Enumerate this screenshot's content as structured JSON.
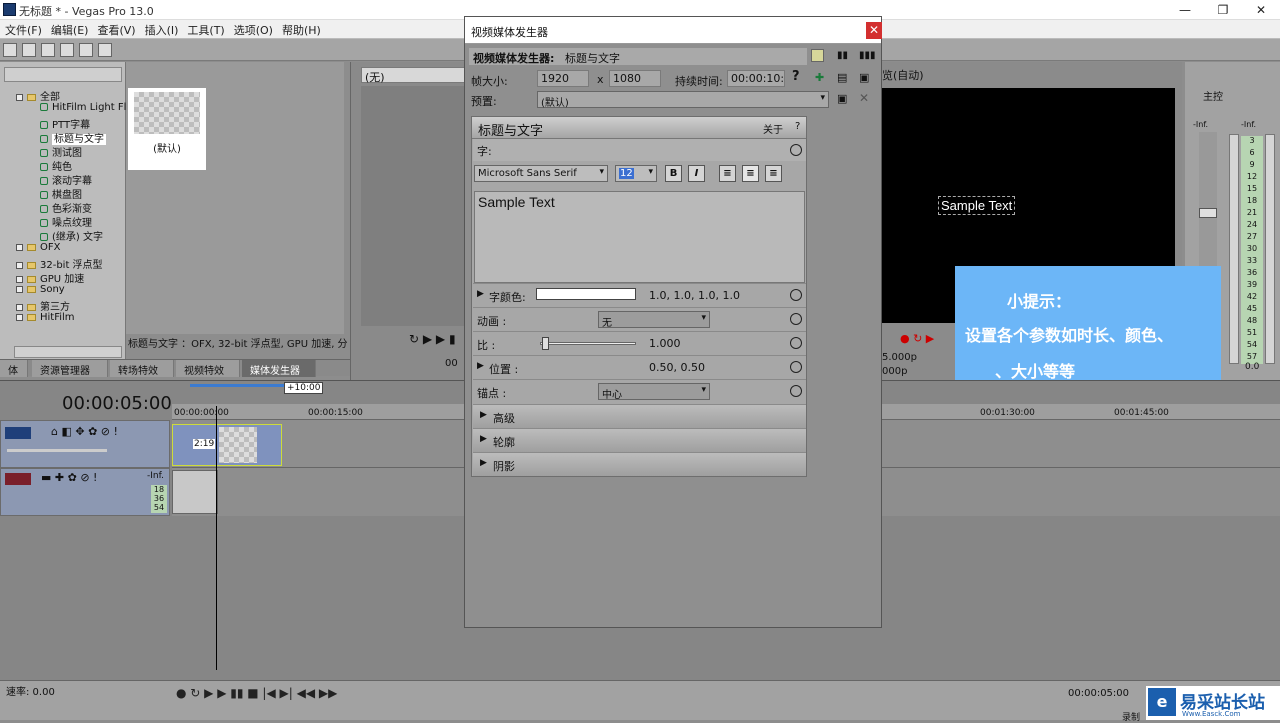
{
  "app": {
    "title": "无标题 * - Vegas Pro 13.0"
  },
  "menu": [
    "文件(F)",
    "编辑(E)",
    "查看(V)",
    "插入(I)",
    "工具(T)",
    "选项(O)",
    "帮助(H)"
  ],
  "explorer": {
    "root": "全部",
    "items": [
      "HitFilm Light Fla",
      "PTT字幕",
      "标题与文字",
      "测试图",
      "纯色",
      "滚动字幕",
      "棋盘图",
      "色彩渐变",
      "噪点纹理",
      "(继承) 文字"
    ],
    "folders": [
      "OFX",
      "32-bit 浮点型",
      "GPU 加速",
      "Sony",
      "第三方",
      "HitFilm"
    ],
    "selected_item": "标题与文字"
  },
  "preset_thumb": {
    "label": "(默认)"
  },
  "status_line": "标题与文字 ：OFX, 32-bit 浮点型, GPU 加速, 分",
  "bottom_tabs": [
    "体",
    "资源管理器",
    "转场特效",
    "视频特效",
    "媒体发生器"
  ],
  "bottom_tab_active": "媒体发生器",
  "trimmer": {
    "dropdown": "(无)",
    "time": "00"
  },
  "dialog": {
    "title": "视频媒体发生器",
    "header_label": "视频媒体发生器:",
    "header_value": "标题与文字",
    "frame_size_label": "帧大小:",
    "width": "1920",
    "x_sep": "x",
    "height": "1080",
    "duration_label": "持续时间:",
    "duration": "00:00:10:00",
    "help": "?",
    "preset_label": "预置:",
    "preset_value": "(默认)",
    "panel_title": "标题与文字",
    "about": "关于",
    "about_help": "?",
    "text_label": "字:",
    "font": "Microsoft Sans Serif",
    "font_size": "12",
    "bold": "B",
    "italic": "I",
    "sample_text": "Sample Text",
    "text_color_label": "字颜色:",
    "text_color_value": "1.0, 1.0, 1.0, 1.0",
    "animation_label": "动画 :",
    "animation_value": "无",
    "scale_label": "比 :",
    "scale_value": "1.000",
    "position_label": "位置 :",
    "position_value": "0.50, 0.50",
    "anchor_label": "锚点 :",
    "anchor_value": "中心",
    "advanced": "高级",
    "outline": "轮廓",
    "shadow": "阴影"
  },
  "preview": {
    "mode": "览(自动)",
    "overlay_text": "Sample Text",
    "info1": "5.000p",
    "info2": "000p"
  },
  "mixer": {
    "label": "主控",
    "meter_top": "-Inf.",
    "meter_ticks": [
      "3",
      "6",
      "9",
      "12",
      "15",
      "18",
      "21",
      "24",
      "27",
      "30",
      "33",
      "36",
      "39",
      "42",
      "45",
      "48",
      "51",
      "54",
      "57"
    ],
    "bottom": "0.0"
  },
  "tip": {
    "title": "小提示：",
    "line1": "设置各个参数如时长、颜色、",
    "line2": "、大小等等"
  },
  "timeline": {
    "timecode": "00:00:05:00",
    "marker": "+10:00",
    "ruler": [
      "00:00:00:00",
      "00:00:15:00",
      "00:01:30:00",
      "00:01:45:00"
    ],
    "clip_label": "2:19",
    "audio_inf": "-Inf.",
    "audio_levels": [
      "18",
      "36",
      "54"
    ]
  },
  "transport": {
    "rate": "速率: 0.00",
    "time": "00:00:05:00",
    "record_label": "录制"
  },
  "watermark": {
    "cn": "易采站长站",
    "en": "Www.Easck.Com"
  }
}
